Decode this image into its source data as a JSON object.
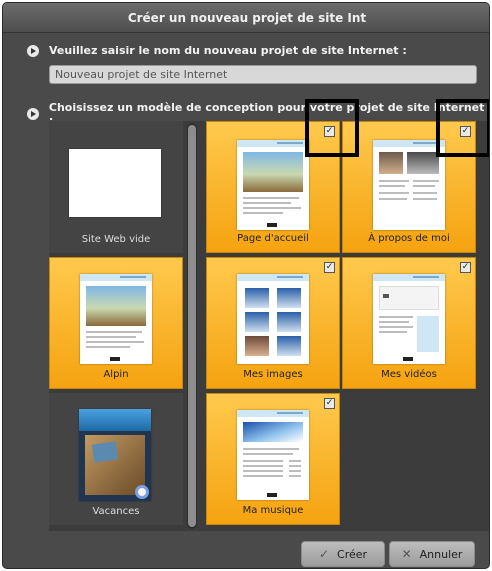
{
  "window": {
    "title": "Créer un nouveau projet de site Int"
  },
  "step1": {
    "label": "Veuillez saisir le nom du nouveau projet de site Internet :"
  },
  "name_input": {
    "value": "Nouveau projet de site Internet"
  },
  "step2": {
    "label": "Choisissez un modèle de conception pour votre projet de site Internet :"
  },
  "templates": [
    {
      "label": "Site Web vide",
      "selected": false,
      "checked": false
    },
    {
      "label": "Page d'accueil",
      "selected": true,
      "checked": true
    },
    {
      "label": "À propos de moi",
      "selected": true,
      "checked": true
    },
    {
      "label": "Alpin",
      "selected": true,
      "checked": false
    },
    {
      "label": "Mes images",
      "selected": true,
      "checked": true
    },
    {
      "label": "Mes vidéos",
      "selected": true,
      "checked": true
    },
    {
      "label": "Vacances",
      "selected": false,
      "checked": false
    },
    {
      "label": "Ma musique",
      "selected": true,
      "checked": true
    }
  ],
  "check_glyph": "✓",
  "buttons": {
    "create": "Créer",
    "cancel": "Annuler"
  },
  "icons": {
    "create": "check-icon",
    "cancel": "close-icon"
  },
  "colors": {
    "tile_selected": "#f5a310",
    "window_bg": "#4a4a4a"
  }
}
